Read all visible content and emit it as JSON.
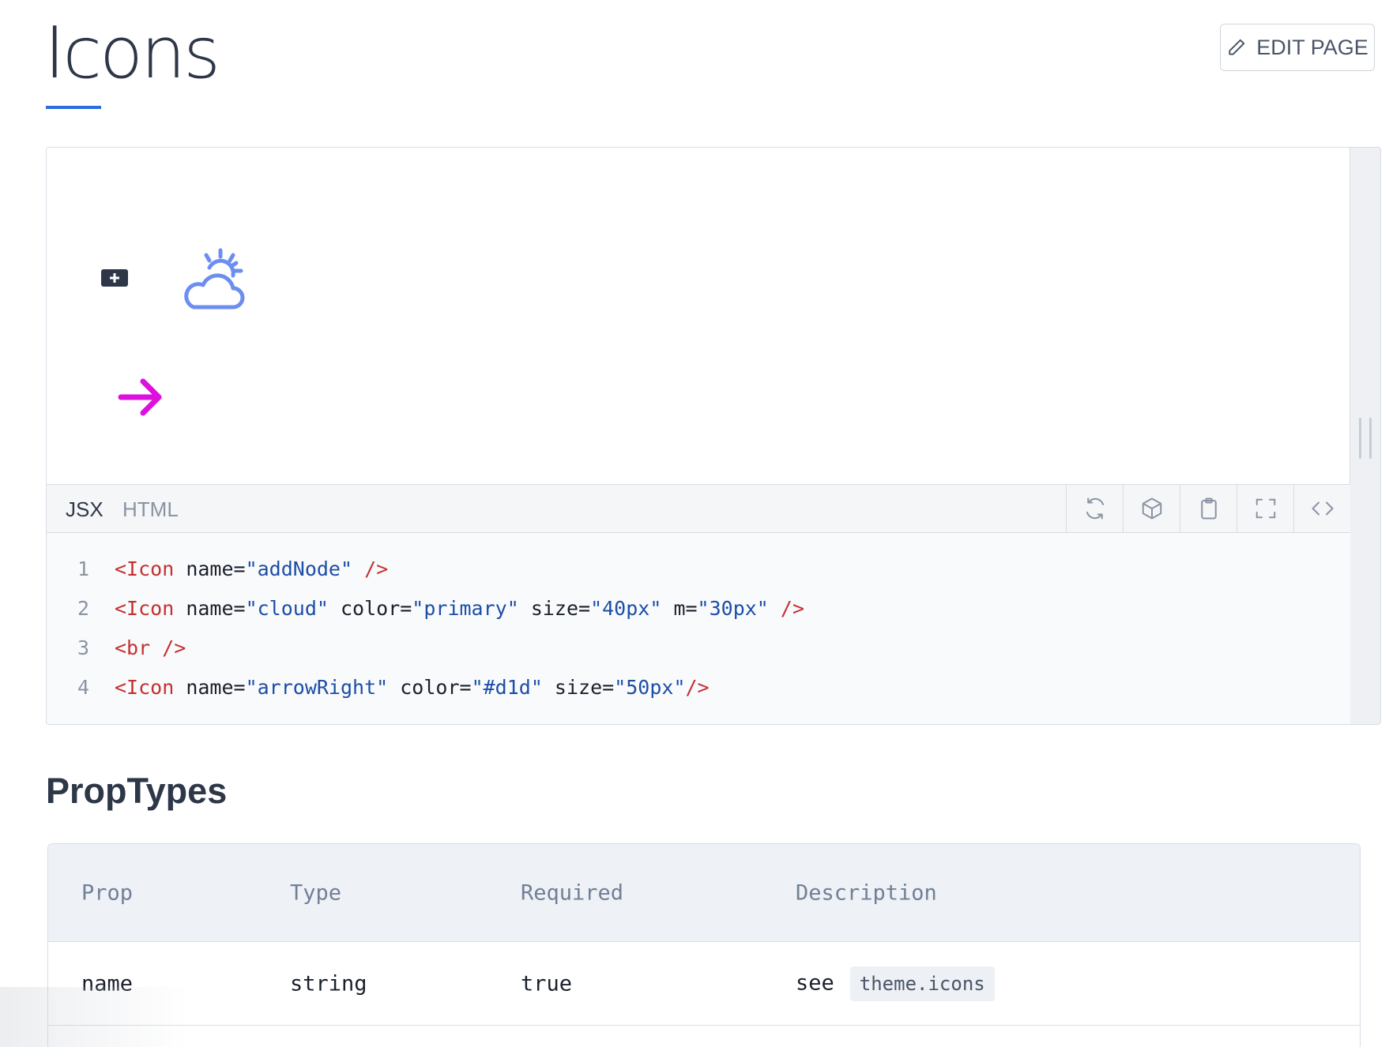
{
  "page": {
    "title": "Icons",
    "edit_button_label": "EDIT PAGE"
  },
  "playground": {
    "preview_icons": [
      {
        "name": "addNode",
        "color": "#2d3748",
        "icon": "add-node-icon"
      },
      {
        "name": "cloud",
        "color": "#6b8ef0",
        "icon": "cloud-sun-icon"
      },
      {
        "name": "arrowRight",
        "color": "#dd11dd",
        "icon": "arrow-right-icon"
      }
    ],
    "tabs": [
      {
        "label": "JSX",
        "active": true
      },
      {
        "label": "HTML",
        "active": false
      }
    ],
    "toolbar_icons": [
      "refresh-icon",
      "codesandbox-icon",
      "clipboard-icon",
      "fullscreen-icon",
      "code-icon"
    ],
    "code_lines": [
      {
        "no": "1",
        "tokens": [
          {
            "t": "tag",
            "v": "<Icon"
          },
          {
            "t": "attr",
            "v": " name="
          },
          {
            "t": "str",
            "v": "\"addNode\""
          },
          {
            "t": "tag",
            "v": " />"
          }
        ]
      },
      {
        "no": "2",
        "tokens": [
          {
            "t": "tag",
            "v": "<Icon"
          },
          {
            "t": "attr",
            "v": " name="
          },
          {
            "t": "str",
            "v": "\"cloud\""
          },
          {
            "t": "attr",
            "v": " color="
          },
          {
            "t": "str",
            "v": "\"primary\""
          },
          {
            "t": "attr",
            "v": " size="
          },
          {
            "t": "str",
            "v": "\"40px\""
          },
          {
            "t": "attr",
            "v": " m="
          },
          {
            "t": "str",
            "v": "\"30px\""
          },
          {
            "t": "tag",
            "v": " />"
          }
        ]
      },
      {
        "no": "3",
        "tokens": [
          {
            "t": "tag",
            "v": "<br"
          },
          {
            "t": "tag",
            "v": " />"
          }
        ]
      },
      {
        "no": "4",
        "tokens": [
          {
            "t": "tag",
            "v": "<Icon"
          },
          {
            "t": "attr",
            "v": " name="
          },
          {
            "t": "str",
            "v": "\"arrowRight\""
          },
          {
            "t": "attr",
            "v": " color="
          },
          {
            "t": "str",
            "v": "\"#d1d\""
          },
          {
            "t": "attr",
            "v": " size="
          },
          {
            "t": "str",
            "v": "\"50px\""
          },
          {
            "t": "tag",
            "v": "/>"
          }
        ]
      }
    ]
  },
  "proptypes": {
    "title": "PropTypes",
    "headers": [
      "Prop",
      "Type",
      "Required",
      "Description"
    ],
    "rows": [
      {
        "prop": "name",
        "type": "string",
        "required": "true",
        "description": "see",
        "description_code": "theme.icons"
      }
    ]
  },
  "colors": {
    "accent": "#2b6cdf",
    "tag": "#c53030",
    "string": "#1c4ea6",
    "cloud": "#6b8ef0",
    "arrow": "#dd11dd"
  }
}
